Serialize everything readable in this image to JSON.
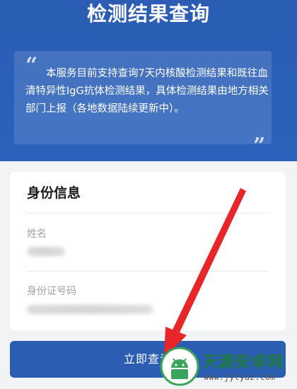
{
  "header": {
    "title": "检测结果查询",
    "notice_open_quote": "“",
    "notice_close_quote": "”",
    "notice_text": "本服务目前支持查询7天内核酸检测结果和既往血清特异性IgG抗体检测结果，具体检测结果由地方相关部门上报（各地数据陆续更新中）。"
  },
  "identity_card": {
    "title": "身份信息",
    "name_label": "姓名",
    "id_label": "身份证号码"
  },
  "submit": {
    "label": "立即查询"
  },
  "watermark": {
    "title": "天源安卓网",
    "url": "www.jytyaz.com"
  },
  "colors": {
    "brand_blue": "#2b5db2",
    "arrow_red": "#e8262a",
    "watermark_green": "#1f7a3f"
  },
  "icons": [
    "quote-open-icon",
    "quote-close-icon",
    "red-arrow-annotation",
    "android-logo-icon"
  ]
}
